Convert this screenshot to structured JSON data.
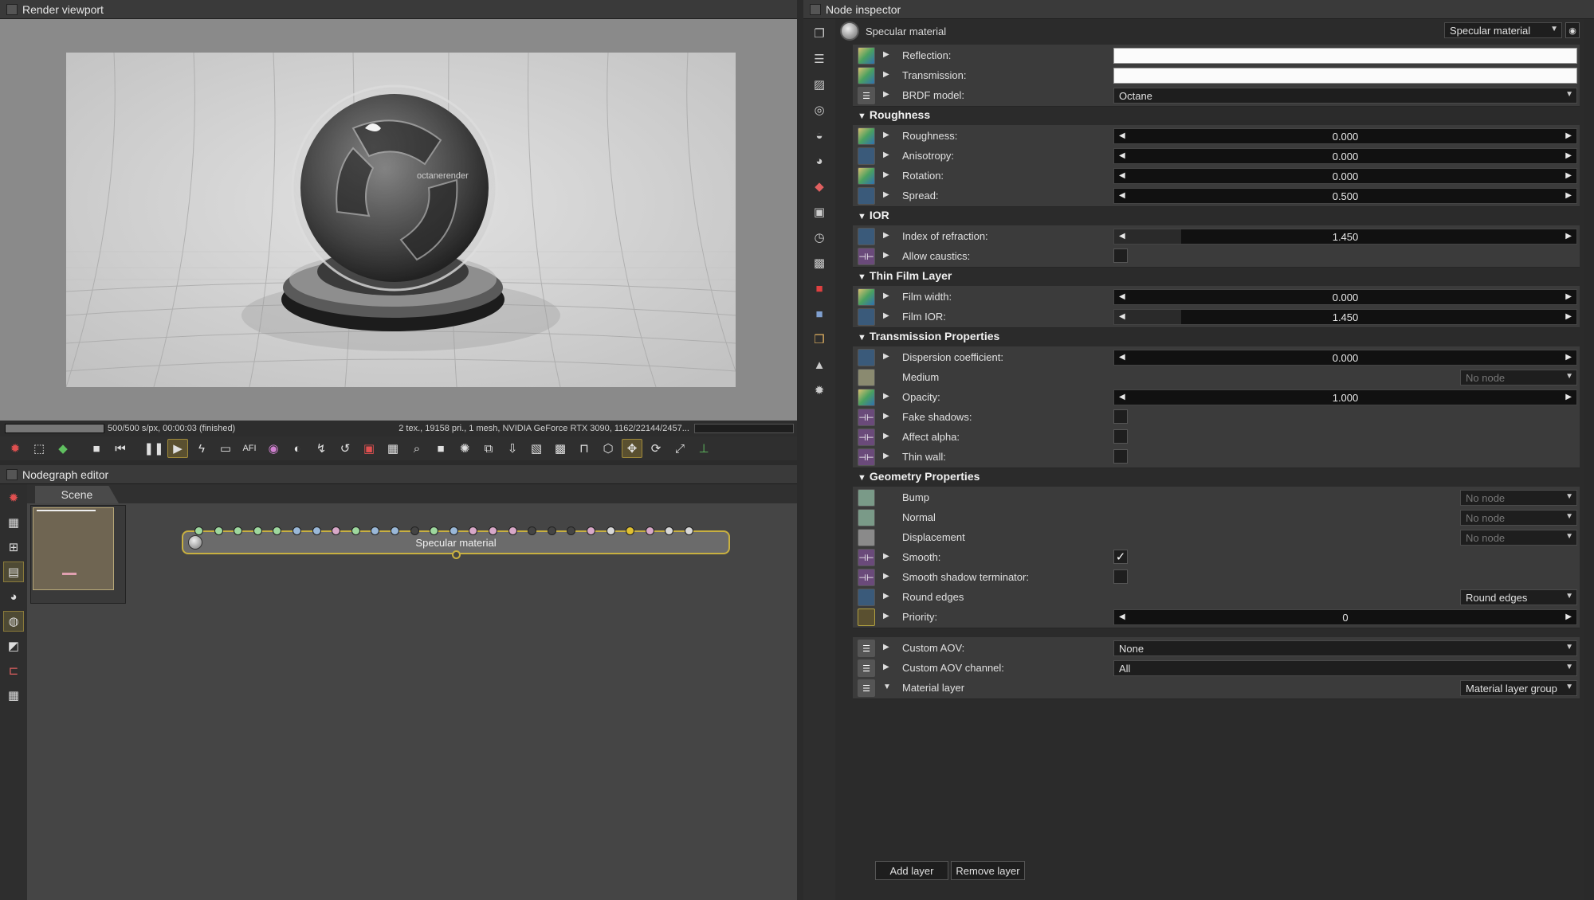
{
  "viewport": {
    "title": "Render viewport",
    "status_left": "500/500 s/px, 00:00:03 (finished)",
    "status_right": "2 tex., 19158 pri., 1 mesh, NVIDIA GeForce RTX 3090, 1162/22144/2457...",
    "render_logo": "octanerender"
  },
  "nodegraph": {
    "title": "Nodegraph editor",
    "tab_label": "Scene",
    "node_label": "Specular material",
    "pin_colors": [
      "#9ed89e",
      "#9ed89e",
      "#9ed89e",
      "#9ed89e",
      "#9ed89e",
      "#9ab8d8",
      "#9ab8d8",
      "#d8a8c8",
      "#9ed89e",
      "#9ab8d8",
      "#9ab8d8",
      "#444444",
      "#9ed89e",
      "#9ab8d8",
      "#d8a8c8",
      "#d8a8c8",
      "#d8a8c8",
      "#444444",
      "#444444",
      "#444444",
      "#d8a8c8",
      "#d8d8d8",
      "#e0c030",
      "#d8a8c8",
      "#d8d8d8",
      "#d8d8d8"
    ]
  },
  "inspector": {
    "title": "Node inspector",
    "node_name": "Specular material",
    "node_type": "Specular material",
    "add_layer": "Add layer",
    "remove_layer": "Remove layer",
    "rows": [
      {
        "label": "Reflection:",
        "type": "color",
        "value": ""
      },
      {
        "label": "Transmission:",
        "type": "color",
        "value": ""
      },
      {
        "label": "BRDF model:",
        "type": "enum",
        "value": "Octane"
      },
      {
        "section": "Roughness"
      },
      {
        "label": "Roughness:",
        "type": "float",
        "value": "0.000",
        "fill": 0
      },
      {
        "label": "Anisotropy:",
        "type": "float",
        "value": "0.000",
        "fill": 0
      },
      {
        "label": "Rotation:",
        "type": "float",
        "value": "0.000",
        "fill": 0
      },
      {
        "label": "Spread:",
        "type": "float",
        "value": "0.500",
        "fill": 0
      },
      {
        "section": "IOR"
      },
      {
        "label": "Index of refraction:",
        "type": "float",
        "value": "1.450",
        "fill": 0.145
      },
      {
        "label": "Allow caustics:",
        "type": "bool",
        "value": false
      },
      {
        "section": "Thin Film Layer"
      },
      {
        "label": "Film width:",
        "type": "float",
        "value": "0.000",
        "fill": 0
      },
      {
        "label": "Film IOR:",
        "type": "float",
        "value": "1.450",
        "fill": 0.145
      },
      {
        "section": "Transmission Properties"
      },
      {
        "label": "Dispersion coefficient:",
        "type": "float",
        "value": "0.000",
        "fill": 0
      },
      {
        "label": "Medium",
        "type": "link",
        "value": "No node"
      },
      {
        "label": "Opacity:",
        "type": "float",
        "value": "1.000",
        "fill": 0
      },
      {
        "label": "Fake shadows:",
        "type": "bool",
        "value": false
      },
      {
        "label": "Affect alpha:",
        "type": "bool",
        "value": false
      },
      {
        "label": "Thin wall:",
        "type": "bool",
        "value": false
      },
      {
        "section": "Geometry Properties"
      },
      {
        "label": "Bump",
        "type": "link",
        "value": "No node"
      },
      {
        "label": "Normal",
        "type": "link",
        "value": "No node"
      },
      {
        "label": "Displacement",
        "type": "link",
        "value": "No node"
      },
      {
        "label": "Smooth:",
        "type": "bool",
        "value": true
      },
      {
        "label": "Smooth shadow terminator:",
        "type": "bool",
        "value": false
      },
      {
        "label": "Round edges",
        "type": "link2",
        "value": "Round edges"
      },
      {
        "label": "Priority:",
        "type": "int",
        "value": "0",
        "fill": 0
      },
      {
        "gap": true
      },
      {
        "label": "Custom AOV:",
        "type": "enum",
        "value": "None"
      },
      {
        "label": "Custom AOV channel:",
        "type": "enum",
        "value": "All"
      },
      {
        "label": "Material layer",
        "type": "link2",
        "value": "Material layer group"
      }
    ]
  }
}
